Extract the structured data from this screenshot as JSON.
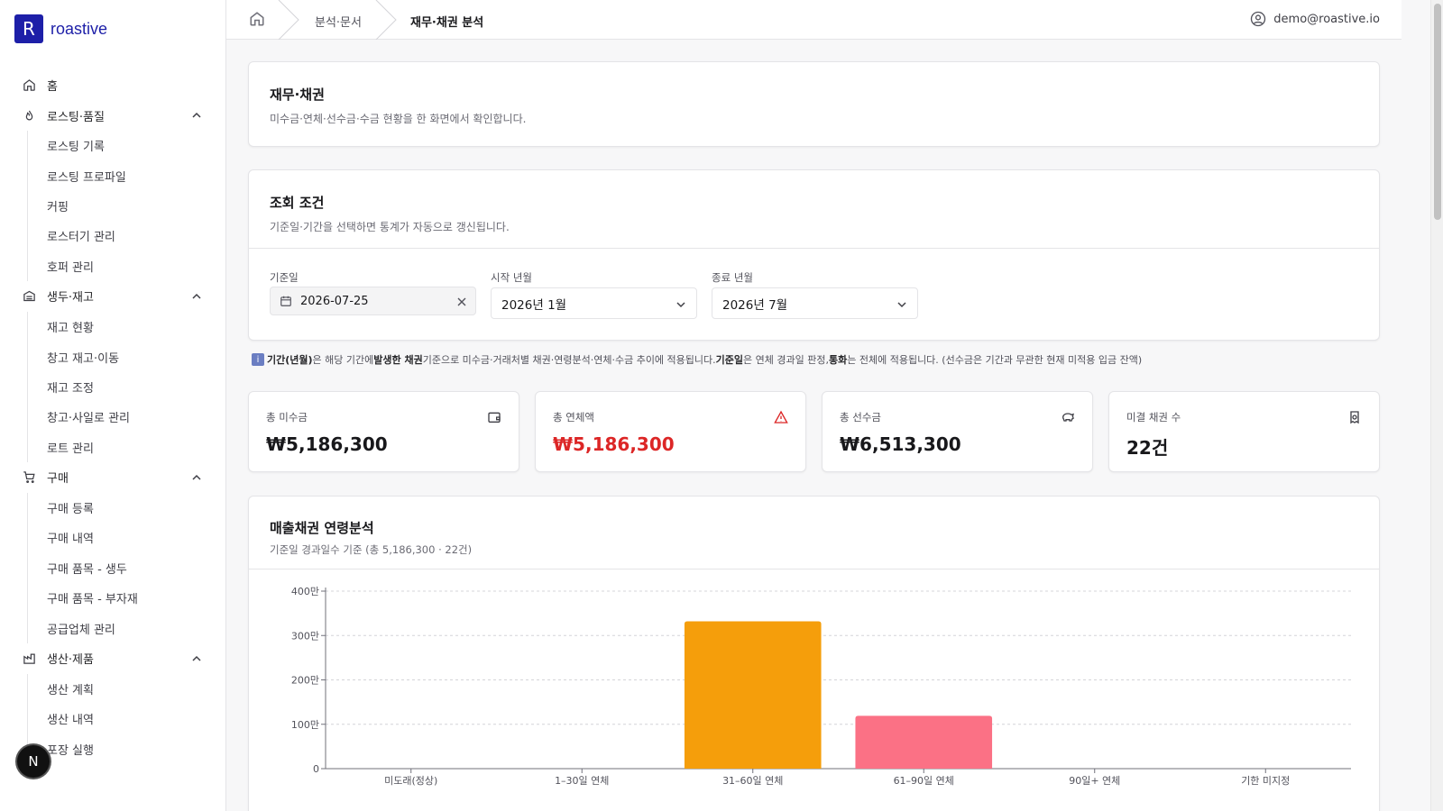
{
  "brand": {
    "logo_letter": "R",
    "name": "roastive"
  },
  "sidebar": {
    "home": "홈",
    "groups": [
      {
        "label": "로스팅·품질",
        "icon": "flame-icon",
        "items": [
          "로스팅 기록",
          "로스팅 프로파일",
          "커핑",
          "로스터기 관리",
          "호퍼 관리"
        ]
      },
      {
        "label": "생두·재고",
        "icon": "warehouse-icon",
        "items": [
          "재고 현황",
          "창고 재고·이동",
          "재고 조정",
          "창고·사일로 관리",
          "로트 관리"
        ]
      },
      {
        "label": "구매",
        "icon": "cart-icon",
        "items": [
          "구매 등록",
          "구매 내역",
          "구매 품목 - 생두",
          "구매 품목 - 부자재",
          "공급업체 관리"
        ]
      },
      {
        "label": "생산·제품",
        "icon": "factory-icon",
        "items": [
          "생산 계획",
          "생산 내역",
          "포장 실행"
        ]
      }
    ]
  },
  "fab": {
    "label": "N"
  },
  "breadcrumb": {
    "items": [
      "분석·문서",
      "재무·채권 분석"
    ]
  },
  "user": {
    "email": "demo@roastive.io"
  },
  "header_card": {
    "title": "재무·채권",
    "description": "미수금·연체·선수금·수금 현황을 한 화면에서 확인합니다."
  },
  "filter_card": {
    "title": "조회 조건",
    "description": "기준일·기간을 선택하면 통계가 자동으로 갱신됩니다.",
    "base_date": {
      "label": "기준일",
      "value": "2026-07-25"
    },
    "start_month": {
      "label": "시작 년월",
      "value": "2026년 1월"
    },
    "end_month": {
      "label": "종료 년월",
      "value": "2026년 7월"
    }
  },
  "note": {
    "icon": "i",
    "parts": [
      "기간(년월)",
      "은 해당 기간에 ",
      "발생한 채권",
      " 기준으로 미수금·거래처별 채권·연령분석·연체·수금 추이에 적용됩니다.",
      "기준일",
      "은 연체 경과일 판정, ",
      "통화",
      "는 전체에 적용됩니다. (선수금은 기간과 무관한 현재 미적용 입금 잔액)"
    ]
  },
  "kpis": [
    {
      "label": "총 미수금",
      "value": "₩5,186,300",
      "icon": "wallet-icon",
      "color": "#18181b"
    },
    {
      "label": "총 연체액",
      "value": "₩5,186,300",
      "icon": "alert-triangle-icon",
      "color": "#dc2626"
    },
    {
      "label": "총 선수금",
      "value": "₩6,513,300",
      "icon": "piggy-bank-icon",
      "color": "#18181b"
    },
    {
      "label": "미결 채권 수",
      "value": "22건",
      "icon": "receipt-icon",
      "color": "#18181b"
    }
  ],
  "aging_card": {
    "title": "매출채권 연령분석",
    "subtitle": "기준일 경과일수 기준 (총 5,186,300 · 22건)"
  },
  "chart_data": {
    "type": "bar",
    "categories": [
      "미도래(정상)",
      "1–30일 연체",
      "31–60일 연체",
      "61–90일 연체",
      "90일+ 연체",
      "기한 미지정"
    ],
    "values": [
      0,
      0,
      3320000,
      1190000,
      0,
      0
    ],
    "colors": [
      "#f59e0b",
      "#f59e0b",
      "#f59e0b",
      "#fb7185",
      "#ef4444",
      "#a1a1aa"
    ],
    "yticks": [
      0,
      1000000,
      2000000,
      3000000,
      4000000
    ],
    "ytick_labels": [
      "0",
      "100만",
      "200만",
      "300만",
      "400만"
    ],
    "ylim": [
      0,
      4000000
    ],
    "grid": true
  }
}
